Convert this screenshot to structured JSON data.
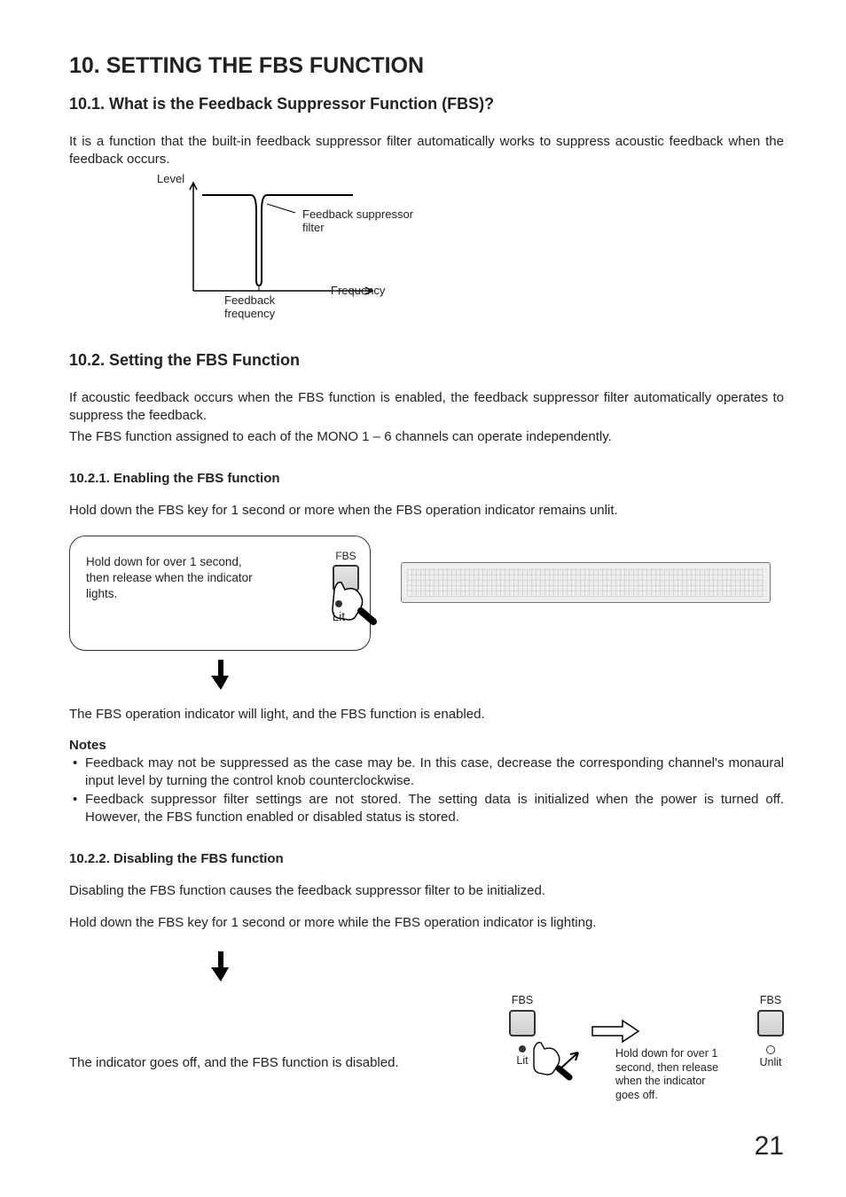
{
  "title": "10. SETTING THE FBS FUNCTION",
  "s101": {
    "heading": "10.1. What is the Feedback Suppressor Function (FBS)?",
    "body": "It is a function that the built-in feedback suppressor filter automatically works to suppress acoustic feedback when the feedback occurs."
  },
  "chart_data": {
    "type": "line",
    "title": "",
    "xlabel": "Frequency",
    "ylabel": "Level",
    "annotations": {
      "feedback_suppressor_filter": "Feedback suppressor filter",
      "feedback_frequency": "Feedback frequency"
    }
  },
  "s102": {
    "heading": "10.2. Setting the FBS Function",
    "body1": "If acoustic feedback occurs when the FBS function is enabled, the feedback suppressor filter automatically operates to suppress the feedback.",
    "body2": "The FBS function assigned to each of the MONO 1 – 6 channels can operate independently."
  },
  "s1021": {
    "heading": "10.2.1. Enabling the FBS function",
    "body": "Hold down the FBS key for 1 second or more when the FBS operation indicator remains unlit.",
    "callout_text": "Hold down for over 1 second, then release when the indicator lights.",
    "fbs_label": "FBS",
    "lit_label": "Lit",
    "result": "The FBS operation indicator will light, and the FBS function is enabled.",
    "notes_label": "Notes",
    "notes": [
      "Feedback may not be suppressed as the case may be. In this case, decrease the corresponding channel's monaural input level by turning the control knob counterclockwise.",
      "Feedback suppressor filter settings are not stored. The setting data is initialized when the power is turned off. However, the FBS function enabled or disabled status is stored."
    ]
  },
  "s1022": {
    "heading": "10.2.2. Disabling the FBS function",
    "body1": "Disabling the FBS function causes the feedback suppressor filter to be initialized.",
    "body2": "Hold down the FBS key for 1 second or more while the FBS operation indicator is lighting.",
    "result": "The indicator goes off, and the FBS function is disabled.",
    "fbs_label": "FBS",
    "lit_label": "Lit",
    "unlit_label": "Unlit",
    "hold_text": "Hold down for over 1 second, then release when the indicator goes off."
  },
  "page_number": "21"
}
